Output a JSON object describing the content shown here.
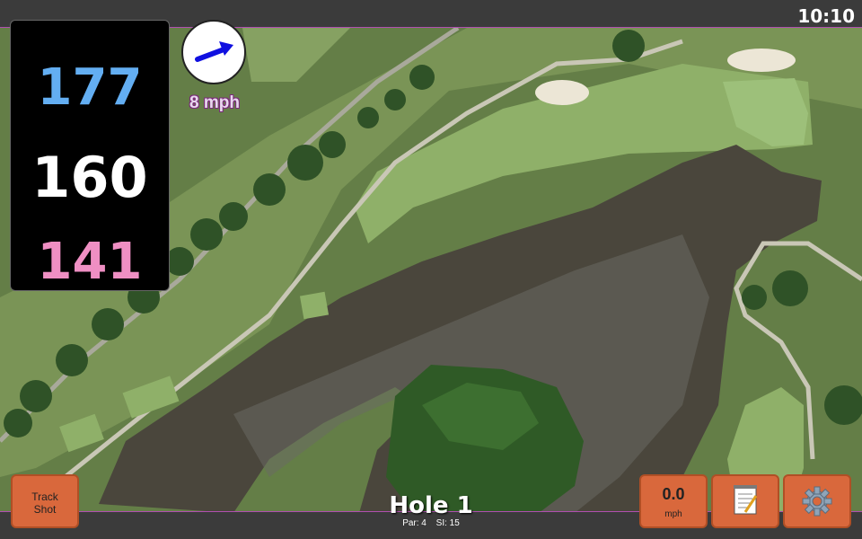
{
  "status": {
    "clock": "10:10"
  },
  "distances": {
    "back": "177",
    "middle": "160",
    "front": "141"
  },
  "wind": {
    "speed_label": "8 mph",
    "direction_icon": "wind-arrow-icon",
    "arrow_color": "#1010e0"
  },
  "hole": {
    "title": "Hole 1",
    "par": "Par: 4",
    "stroke_index": "SI: 15"
  },
  "buttons": {
    "track_shot_line1": "Track",
    "track_shot_line2": "Shot",
    "speed_value": "0.0",
    "speed_unit": "mph",
    "notes_icon": "notepad-icon",
    "settings_icon": "gear-icon"
  },
  "colors": {
    "back_distance": "#63aef2",
    "middle_distance": "#ffffff",
    "front_distance": "#ef8fc3",
    "button_bg": "#d9683c",
    "accent_border": "#b04fb0"
  }
}
